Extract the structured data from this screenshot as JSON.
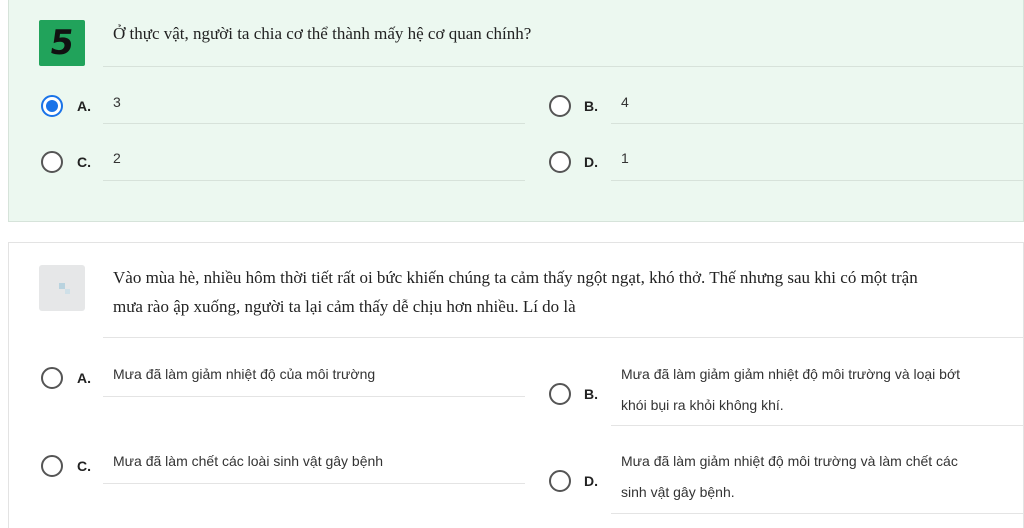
{
  "q1": {
    "number": "5",
    "text": "Ở thực vật, người ta chia cơ thể thành mấy hệ cơ quan chính?",
    "options": [
      {
        "letter": "A.",
        "text": "3",
        "selected": true
      },
      {
        "letter": "B.",
        "text": "4",
        "selected": false
      },
      {
        "letter": "C.",
        "text": "2",
        "selected": false
      },
      {
        "letter": "D.",
        "text": "1",
        "selected": false
      }
    ]
  },
  "q2": {
    "text_line1": "Vào mùa hè, nhiều hôm thời tiết rất oi bức khiến chúng ta cảm thấy ngột ngạt, khó thở. Thế nhưng sau khi có một trận",
    "text_line2": "mưa rào ập xuống, người ta lại cảm thấy dễ chịu hơn nhiều. Lí do là",
    "options": [
      {
        "letter": "A.",
        "text": "Mưa đã làm giảm nhiệt độ của môi trường",
        "selected": false
      },
      {
        "letter": "B.",
        "text_line1": "Mưa đã làm giảm giảm nhiệt độ môi trường và loại bớt",
        "text_line2": "khói bụi ra khỏi không khí.",
        "selected": false
      },
      {
        "letter": "C.",
        "text": "Mưa đã làm chết các loài sinh vật gây bệnh",
        "selected": false
      },
      {
        "letter": "D.",
        "text_line1": "Mưa đã làm giảm nhiệt độ môi trường và làm chết các",
        "text_line2": "sinh vật gây bệnh.",
        "selected": false
      }
    ]
  },
  "colors": {
    "answered_bg": "#ecf8f0",
    "badge_green": "#21a35b",
    "radio_selected": "#1a73e8"
  }
}
